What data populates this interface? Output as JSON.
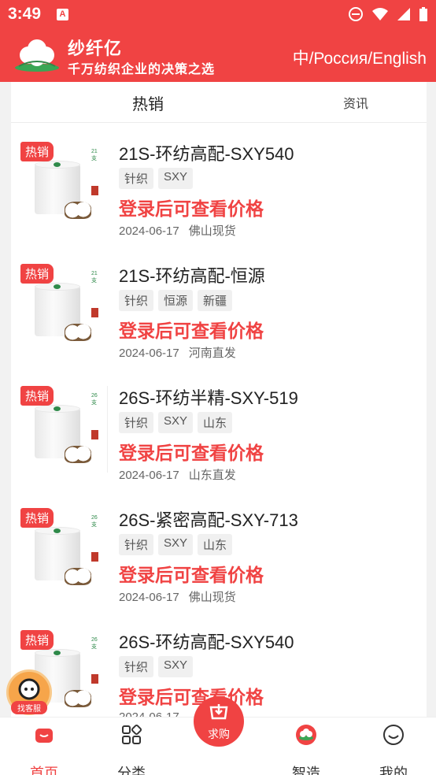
{
  "status": {
    "time": "3:49",
    "app_icon_letter": "A"
  },
  "header": {
    "brand_name": "纱纤亿",
    "slogan": "千万纺织企业的决策之选",
    "language_switch": "中/Россия/English"
  },
  "tabs": [
    {
      "label": "热销",
      "active": true
    },
    {
      "label": "资讯",
      "active": false
    }
  ],
  "products": [
    {
      "badge": "热销",
      "title": "21S-环纺高配-SXY540",
      "tags": [
        "针织",
        "SXY"
      ],
      "price_text": "登录后可查看价格",
      "date": "2024-06-17",
      "location": "佛山现货"
    },
    {
      "badge": "热销",
      "title": "21S-环纺高配-恒源",
      "tags": [
        "针织",
        "恒源",
        "新疆"
      ],
      "price_text": "登录后可查看价格",
      "date": "2024-06-17",
      "location": "河南直发"
    },
    {
      "badge": "热销",
      "title": "26S-环纺半精-SXY-519",
      "tags": [
        "针织",
        "SXY",
        "山东"
      ],
      "price_text": "登录后可查看价格",
      "date": "2024-06-17",
      "location": "山东直发"
    },
    {
      "badge": "热销",
      "title": "26S-紧密高配-SXY-713",
      "tags": [
        "针织",
        "SXY",
        "山东"
      ],
      "price_text": "登录后可查看价格",
      "date": "2024-06-17",
      "location": "佛山现货"
    },
    {
      "badge": "热销",
      "title": "26S-环纺高配-SXY540",
      "tags": [
        "针织",
        "SXY"
      ],
      "price_text": "登录后可查看价格",
      "date": "2024-06-17",
      "location": ""
    }
  ],
  "float_service_label": "找客服",
  "bottom_nav": [
    {
      "label": "首页",
      "icon": "home-icon",
      "active": true
    },
    {
      "label": "分类",
      "icon": "category-grid-icon",
      "active": false
    },
    {
      "label": "求购",
      "icon": "buy-request-icon",
      "active": false
    },
    {
      "label": "智造",
      "icon": "smart-manufacture-icon",
      "active": false
    },
    {
      "label": "我的",
      "icon": "profile-smile-icon",
      "active": false
    }
  ],
  "colors": {
    "brand_red": "#f04343",
    "tag_bg": "#f0f0f0",
    "accent_green": "#2f8a4a"
  }
}
